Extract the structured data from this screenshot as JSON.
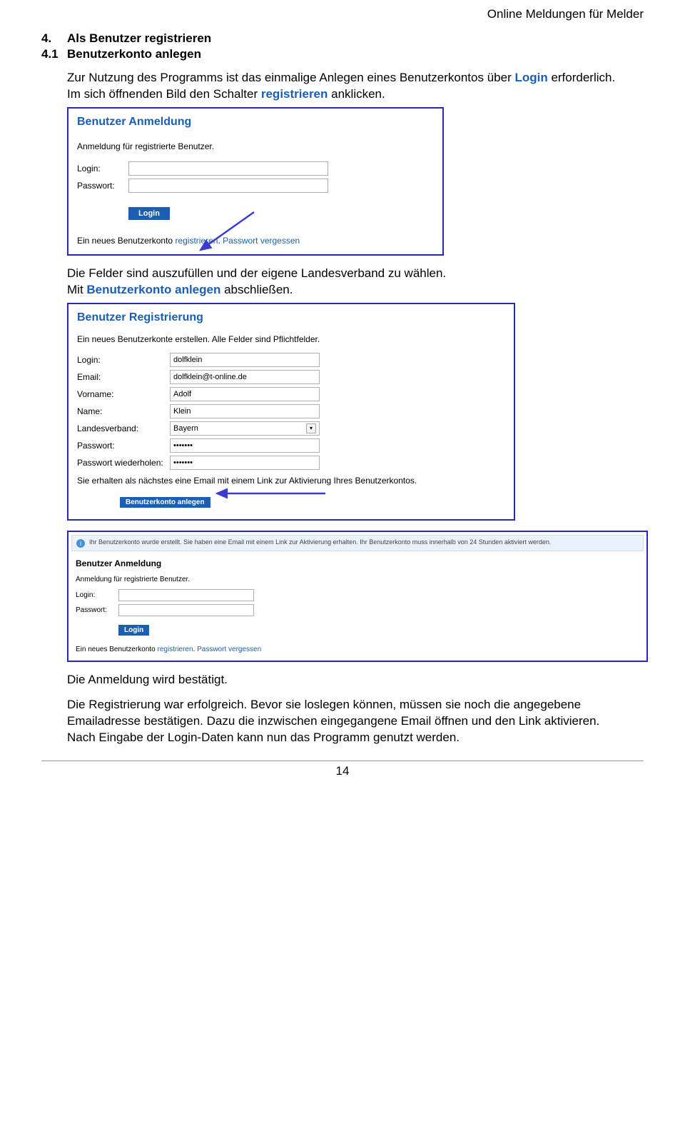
{
  "header": {
    "right_text": "Online Meldungen für Melder"
  },
  "sections": {
    "s4": {
      "num": "4.",
      "title": "Als Benutzer registrieren"
    },
    "s41": {
      "num": "4.1",
      "title": "Benutzerkonto anlegen"
    }
  },
  "paragraphs": {
    "p1a": "Zur Nutzung des Programms ist das einmalige Anlegen eines Benutzerkontos über ",
    "p1_login": "Login",
    "p1b": " erforderlich.",
    "p2a": "Im sich öffnenden Bild den Schalter ",
    "p2_reg": "registrieren",
    "p2b": " anklicken.",
    "p3": "Die Felder sind auszufüllen und der eigene Landesverband zu wählen.",
    "p4a": "Mit ",
    "p4_bk": "Benutzerkonto anlegen",
    "p4b": " abschließen.",
    "p5": "Die Anmeldung wird bestätigt.",
    "p6": "Die Registrierung war erfolgreich. Bevor sie loslegen können, müssen sie noch die angegebene Emailadresse bestätigen. Dazu die inzwischen eingegangene Email öffnen und den Link aktivieren.",
    "p7": "Nach Eingabe der Login-Daten kann nun das Programm genutzt werden."
  },
  "shot1": {
    "title": "Benutzer Anmeldung",
    "desc": "Anmeldung für registrierte Benutzer.",
    "login_label": "Login:",
    "password_label": "Passwort:",
    "login_btn": "Login",
    "reg_prefix": "Ein neues Benutzerkonto ",
    "reg_link": "registrieren",
    "reg_sep": ". ",
    "forgot_link": "Passwort vergessen"
  },
  "shot2": {
    "title": "Benutzer Registrierung",
    "desc": "Ein neues Benutzerkonte erstellen. Alle Felder sind Pflichtfelder.",
    "login_label": "Login:",
    "login_val": "dolfklein",
    "email_label": "Email:",
    "email_val": "dolfklein@t-online.de",
    "vorname_label": "Vorname:",
    "vorname_val": "Adolf",
    "name_label": "Name:",
    "name_val": "Klein",
    "lv_label": "Landesverband:",
    "lv_val": "Bayern",
    "pw_label": "Passwort:",
    "pw_val": "•••••••",
    "pw2_label": "Passwort wiederholen:",
    "pw2_val": "•••••••",
    "note": "Sie erhalten als nächstes eine Email mit einem Link zur Aktivierung Ihres Benutzerkontos.",
    "submit_btn": "Benutzerkonto anlegen"
  },
  "shot3": {
    "info_text": "Ihr Benutzerkonto wurde erstellt. Sie haben eine Email mit einem Link zur Aktivierung erhalten. Ihr Benutzerkonto muss innerhalb von 24 Stunden aktiviert werden.",
    "title": "Benutzer Anmeldung",
    "desc": "Anmeldung für registrierte Benutzer.",
    "login_label": "Login:",
    "password_label": "Passwort:",
    "login_btn": "Login",
    "reg_prefix": "Ein neues Benutzerkonto ",
    "reg_link": "registrieren",
    "reg_sep": ". ",
    "forgot_link": "Passwort vergessen"
  },
  "footer": {
    "page_num": "14"
  }
}
